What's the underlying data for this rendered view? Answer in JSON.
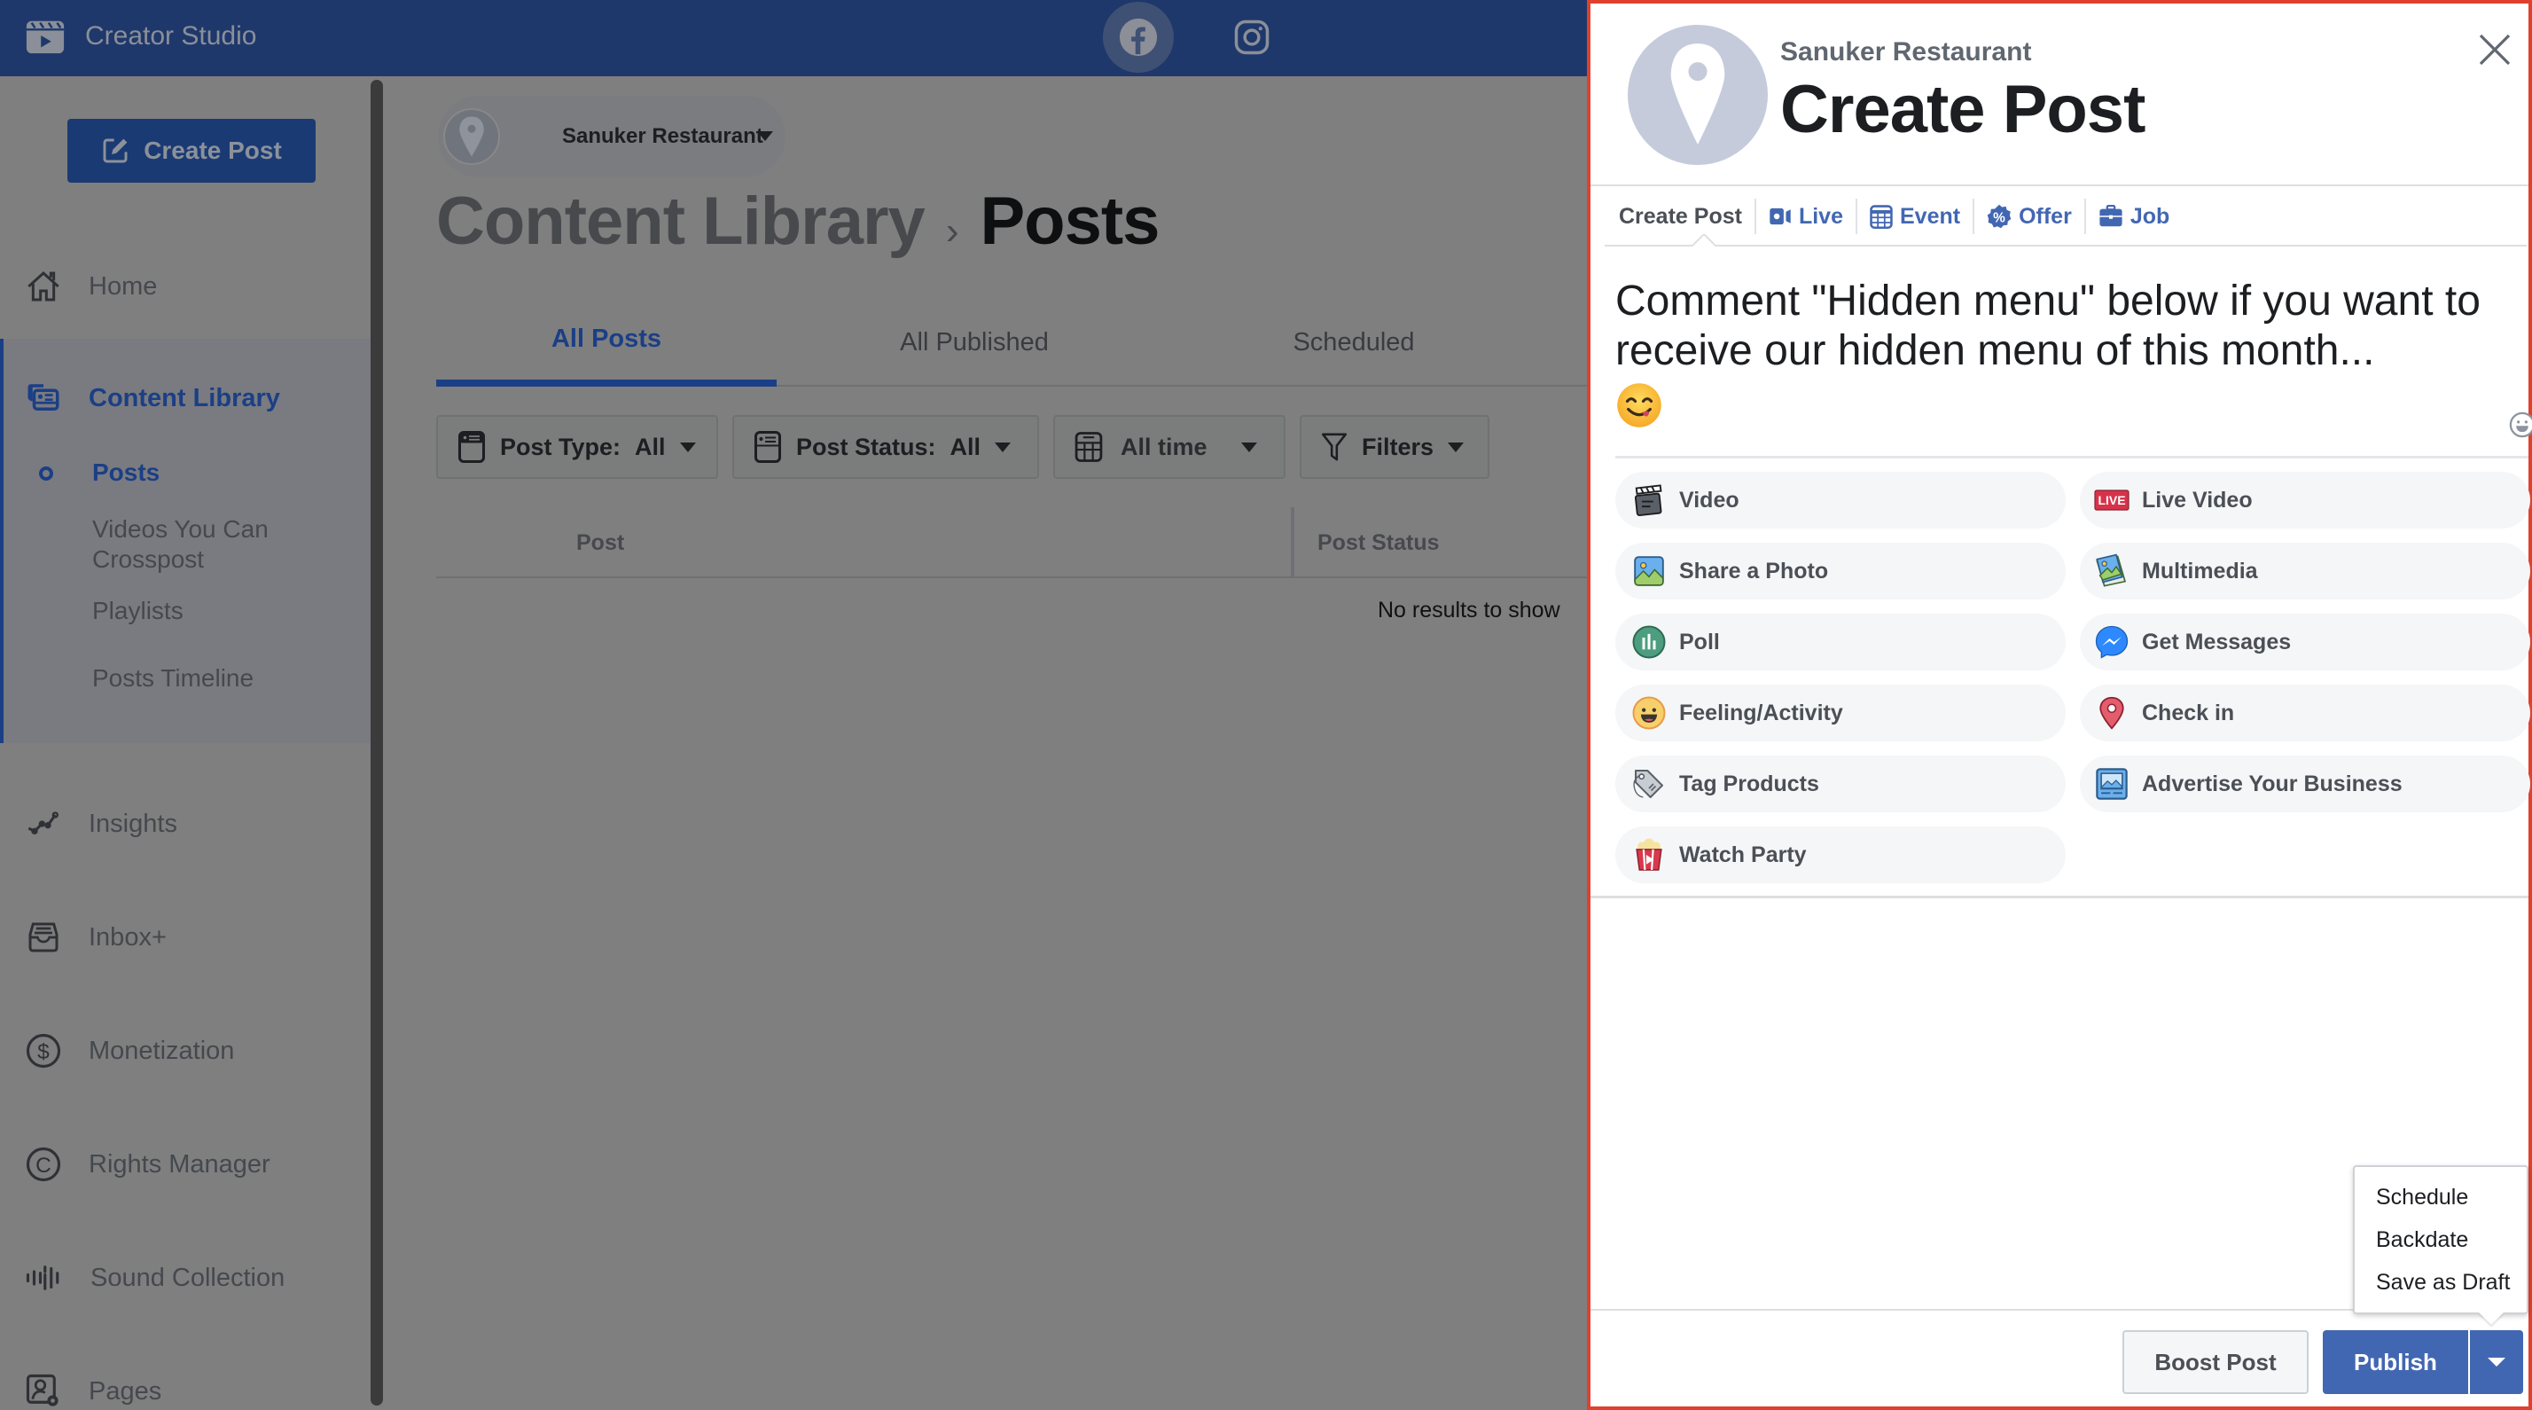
{
  "app": {
    "title": "Creator Studio",
    "platforms": [
      {
        "name": "Facebook",
        "icon": "facebook-icon",
        "active": true
      },
      {
        "name": "Instagram",
        "icon": "instagram-icon",
        "active": false
      }
    ]
  },
  "sidebar": {
    "create_post_label": "Create Post",
    "items": [
      {
        "label": "Home",
        "icon": "home-icon"
      },
      {
        "label": "Content Library",
        "icon": "content-library-icon",
        "active": true
      },
      {
        "label": "Insights",
        "icon": "insights-icon"
      },
      {
        "label": "Inbox+",
        "icon": "inbox-icon"
      },
      {
        "label": "Monetization",
        "icon": "dollar-icon"
      },
      {
        "label": "Rights Manager",
        "icon": "copyright-icon"
      },
      {
        "label": "Sound Collection",
        "icon": "sound-wave-icon"
      },
      {
        "label": "Pages",
        "icon": "pages-settings-icon"
      }
    ],
    "sub_items": [
      {
        "label": "Posts",
        "active": true
      },
      {
        "label": "Videos You Can Crosspost"
      },
      {
        "label": "Playlists"
      },
      {
        "label": "Posts Timeline"
      }
    ]
  },
  "main": {
    "page_selector": "Sanuker Restaurant",
    "breadcrumb": {
      "parent": "Content Library",
      "separator": "›",
      "current": "Posts"
    },
    "tabs": [
      {
        "label": "All Posts",
        "active": true
      },
      {
        "label": "All Published"
      },
      {
        "label": "Scheduled"
      }
    ],
    "filters": [
      {
        "label": "Post Type:",
        "value": "All",
        "icon": "post-type-icon"
      },
      {
        "label": "Post Status:",
        "value": "All",
        "icon": "post-status-icon"
      },
      {
        "label": "All time",
        "value": "",
        "icon": "calendar-icon"
      },
      {
        "label": "Filters",
        "value": "",
        "icon": "filter-icon"
      }
    ],
    "table": {
      "columns": [
        "Post",
        "Post Status"
      ],
      "empty_message": "No results to show"
    }
  },
  "create_post": {
    "page_name": "Sanuker Restaurant",
    "title": "Create Post",
    "close_icon": "close-icon",
    "type_tabs": [
      {
        "label": "Create Post",
        "icon": ""
      },
      {
        "label": "Live",
        "icon": "live-camera-icon"
      },
      {
        "label": "Event",
        "icon": "calendar-icon"
      },
      {
        "label": "Offer",
        "icon": "offer-badge-icon"
      },
      {
        "label": "Job",
        "icon": "briefcase-icon"
      }
    ],
    "post_text": "Comment \"Hidden menu\" below if you want to receive our hidden menu of this month...",
    "post_emoji": "😋",
    "options_left": [
      {
        "label": "Video",
        "icon": "clapperboard-icon"
      },
      {
        "label": "Share a Photo",
        "icon": "photo-icon"
      },
      {
        "label": "Poll",
        "icon": "poll-icon"
      },
      {
        "label": "Feeling/Activity",
        "icon": "smiley-icon"
      },
      {
        "label": "Tag Products",
        "icon": "tag-icon"
      },
      {
        "label": "Watch Party",
        "icon": "popcorn-icon"
      }
    ],
    "options_right": [
      {
        "label": "Live Video",
        "icon": "live-badge-icon",
        "badge": "LIVE"
      },
      {
        "label": "Multimedia",
        "icon": "multimedia-icon"
      },
      {
        "label": "Get Messages",
        "icon": "messenger-icon"
      },
      {
        "label": "Check in",
        "icon": "location-pin-icon"
      },
      {
        "label": "Advertise Your Business",
        "icon": "advertise-icon"
      }
    ],
    "publish_menu": [
      "Schedule",
      "Backdate",
      "Save as Draft"
    ],
    "boost_label": "Boost Post",
    "publish_label": "Publish"
  },
  "colors": {
    "facebook_blue": "#4267b2",
    "header_navy": "#1f386b",
    "highlight_border": "#e0412e",
    "accent_dark_blue": "#1b3f86"
  }
}
